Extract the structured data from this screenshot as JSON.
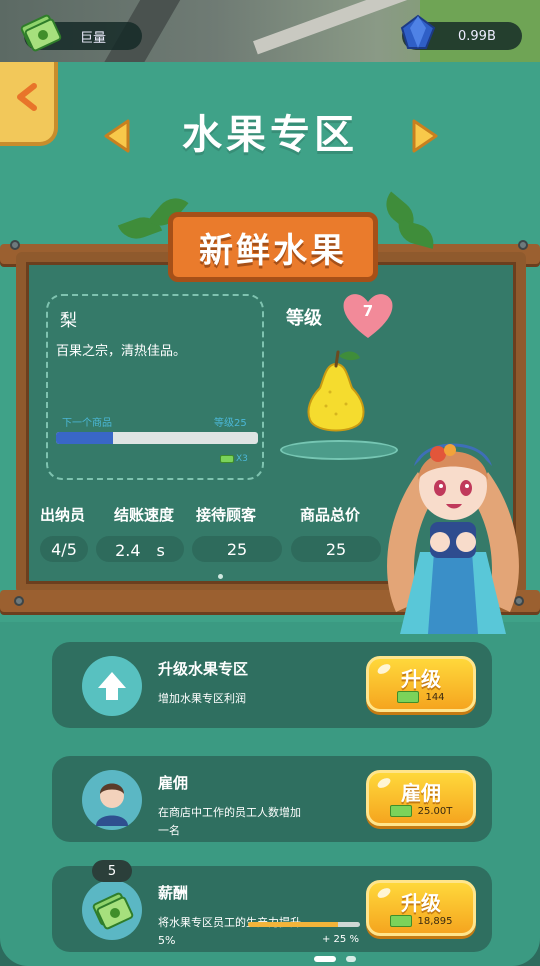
{
  "header": {
    "left_resource": {
      "label": "巨量",
      "icon": "cash-stack-icon"
    },
    "right_resource": {
      "value": "0.99B",
      "icon": "blue-gem-icon"
    }
  },
  "panel": {
    "title": "水果专区",
    "sign": "新鲜水果",
    "item": {
      "name": "梨",
      "description": "百果之宗，清热佳品。",
      "next_label": "下一个商品",
      "level_label": "等级25",
      "progress": 0.28,
      "multiplier": "X3"
    },
    "grade_label": "等级",
    "grade_value": "7",
    "stats": [
      {
        "label": "出纳员",
        "value": "4/5"
      },
      {
        "label": "结账速度",
        "value": "2.4　s"
      },
      {
        "label": "接待顾客",
        "value": "25"
      },
      {
        "label": "商品总价",
        "value": "25"
      }
    ]
  },
  "cards": [
    {
      "title": "升级水果专区",
      "desc": "增加水果专区利润",
      "button": "升级",
      "cost": "144",
      "icon": "arrow-up-icon"
    },
    {
      "title": "雇佣",
      "desc": "在商店中工作的员工人数增加一名",
      "button": "雇佣",
      "cost": "25.00T",
      "icon": "worker-avatar-icon"
    },
    {
      "title": "薪酬",
      "desc": "将水果专区员工的生产力提升5%",
      "button": "升级",
      "cost": "18,895",
      "icon": "cash-stack-icon",
      "badge": "5",
      "progress": 0.8,
      "progress_text": "+ 25 %"
    }
  ],
  "colors": {
    "panel": "#3b9a82",
    "board": "#357a69",
    "wood": "#8f5a2d",
    "sign": "#ea7b2c",
    "button": "#f5a51f",
    "heart": "#f28a99"
  }
}
